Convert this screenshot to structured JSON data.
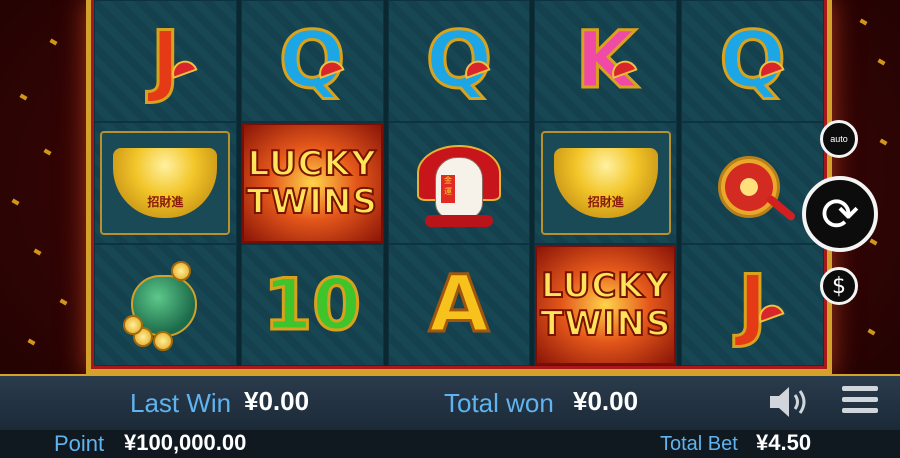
{
  "reels": [
    [
      {
        "symbol": "J",
        "kind": "letter-J"
      },
      {
        "symbol": "ingot",
        "kind": "ingot",
        "text": "招財進"
      },
      {
        "symbol": "money-bag",
        "kind": "bag"
      }
    ],
    [
      {
        "symbol": "Q",
        "kind": "letter-Q"
      },
      {
        "symbol": "wild",
        "kind": "wild",
        "line1": "LUCKY",
        "line2": "TWINS"
      },
      {
        "symbol": "10",
        "kind": "letter-10"
      }
    ],
    [
      {
        "symbol": "Q",
        "kind": "letter-Q"
      },
      {
        "symbol": "lucky-cat",
        "kind": "cat",
        "text": "金運"
      },
      {
        "symbol": "A",
        "kind": "letter-A"
      }
    ],
    [
      {
        "symbol": "K",
        "kind": "letter-K"
      },
      {
        "symbol": "ingot",
        "kind": "ingot",
        "text": "招財進"
      },
      {
        "symbol": "wild",
        "kind": "wild",
        "line1": "LUCKY",
        "line2": "TWINS"
      }
    ],
    [
      {
        "symbol": "Q",
        "kind": "letter-Q"
      },
      {
        "symbol": "medallion",
        "kind": "medal"
      },
      {
        "symbol": "J",
        "kind": "letter-J"
      }
    ]
  ],
  "controls": {
    "auto_label": "auto",
    "spin_glyph": "⟳",
    "bet_glyph": "$"
  },
  "status": {
    "last_win_label": "Last Win",
    "last_win_value": "¥0.00",
    "total_won_label": "Total won",
    "total_won_value": "¥0.00",
    "point_label": "Point",
    "point_value": "¥100,000.00",
    "total_bet_label": "Total Bet",
    "total_bet_value": "¥4.50"
  },
  "icons": {
    "speaker": "speaker-icon",
    "menu": "hamburger-menu-icon"
  }
}
